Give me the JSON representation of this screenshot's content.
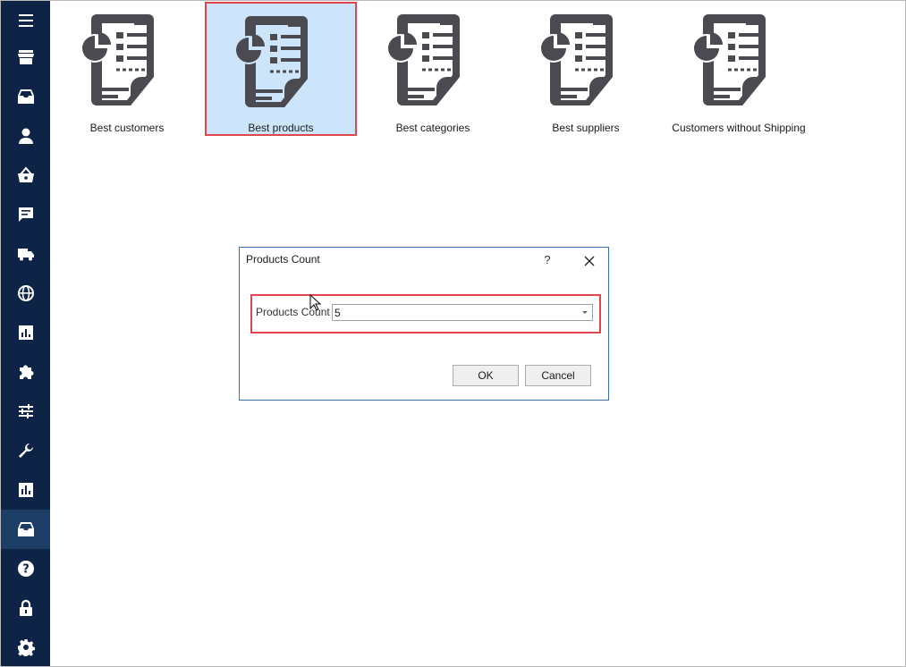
{
  "sidebar": {
    "items": [
      {
        "icon": "menu-icon"
      },
      {
        "icon": "store-icon"
      },
      {
        "icon": "inbox-icon"
      },
      {
        "icon": "person-icon"
      },
      {
        "icon": "basket-icon"
      },
      {
        "icon": "chat-icon"
      },
      {
        "icon": "truck-icon"
      },
      {
        "icon": "globe-icon"
      },
      {
        "icon": "bar-chart-icon"
      },
      {
        "icon": "puzzle-icon"
      },
      {
        "icon": "sliders-icon"
      },
      {
        "icon": "wrench-icon"
      },
      {
        "icon": "report-icon"
      },
      {
        "icon": "archive-icon",
        "active": true
      },
      {
        "icon": "help-icon"
      },
      {
        "icon": "lock-icon"
      },
      {
        "icon": "gear-icon"
      }
    ]
  },
  "reports": [
    {
      "label": "Best customers"
    },
    {
      "label": "Best products",
      "selected": true
    },
    {
      "label": "Best categories"
    },
    {
      "label": "Best suppliers"
    },
    {
      "label": "Customers without Shipping"
    }
  ],
  "dialog": {
    "title": "Products Count",
    "help": "?",
    "field_label": "Products Count",
    "field_value": "5",
    "ok_label": "OK",
    "cancel_label": "Cancel"
  },
  "colors": {
    "sidebar_bg": "#0d2447",
    "sidebar_active": "#1c3d66",
    "highlight": "#e0474c",
    "selected_tile": "#cce5fb",
    "doc_icon": "#4a4a50"
  }
}
